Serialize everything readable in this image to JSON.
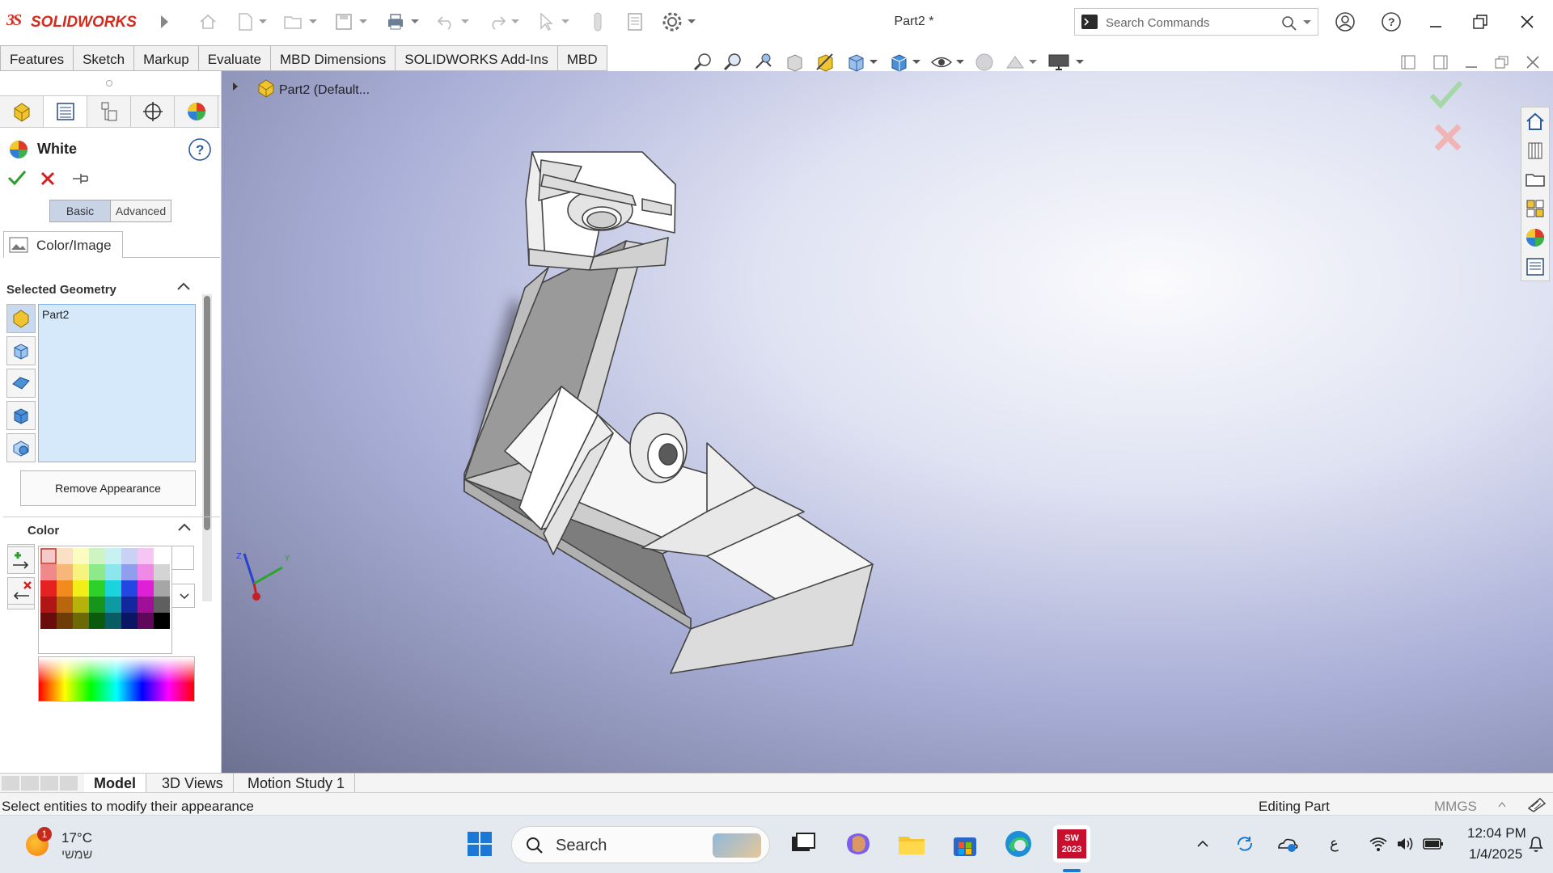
{
  "app": {
    "brand_ds": "3S",
    "brand": "SOLIDWORKS",
    "document_title": "Part2 *"
  },
  "search": {
    "placeholder": "Search Commands"
  },
  "command_tabs": [
    "Features",
    "Sketch",
    "Markup",
    "Evaluate",
    "MBD Dimensions",
    "SOLIDWORKS Add-Ins",
    "MBD"
  ],
  "tree": {
    "root_label": "Part2  (Default..."
  },
  "property_manager": {
    "title": "White",
    "modes": {
      "basic": "Basic",
      "advanced": "Advanced"
    },
    "subtab": "Color/Image",
    "selected_geometry": {
      "heading": "Selected Geometry",
      "items": [
        "Part2"
      ],
      "remove_button": "Remove Appearance"
    },
    "color": {
      "heading": "Color",
      "hex_value": "",
      "palette_select": "standard"
    }
  },
  "bottom_tabs": [
    "Model",
    "3D Views",
    "Motion Study 1"
  ],
  "status": {
    "message": "Select entities to modify their appearance",
    "mode": "Editing Part",
    "units": "MMGS"
  },
  "taskbar": {
    "weather_temp": "17°C",
    "weather_label": "שמשי",
    "weather_badge": "1",
    "search_label": "Search",
    "app_badge": "SW 2023",
    "tray_lang": "ع",
    "time": "12:04 PM",
    "date": "1/4/2025"
  },
  "colors": {
    "brand_red": "#d52b1e",
    "accept_green": "#2e9e2e",
    "cancel_red": "#d41f1f",
    "selection_blue": "#d5e9fb",
    "taskbar": "#e3e9ee"
  }
}
